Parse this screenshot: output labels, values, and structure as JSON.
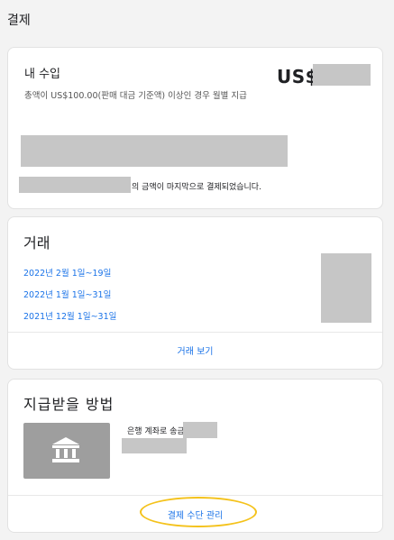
{
  "page": {
    "title": "결제"
  },
  "earnings": {
    "title": "내 수입",
    "amount_prefix": "US$",
    "description": "총액이 US$100.00(판매 대금 기준액) 이상인 경우 월별 지급",
    "last_payment_suffix": "의 금액이 마지막으로 결제되었습니다."
  },
  "transactions": {
    "title": "거래",
    "periods": [
      {
        "label": "2022년 2월 1일~19일"
      },
      {
        "label": "2022년 1월 1일~31일"
      },
      {
        "label": "2021년 12월 1일~31일"
      }
    ],
    "view_label": "거래 보기"
  },
  "payment_method": {
    "title": "지급받을 방법",
    "bank_label": "은행 계좌로 송금",
    "manage_label": "결제 수단 관리",
    "icon": "bank-icon"
  },
  "colors": {
    "link": "#1a73e8",
    "redaction": "#c6c6c6",
    "highlight": "#f4c21b",
    "bank_tile": "#9e9e9e"
  }
}
